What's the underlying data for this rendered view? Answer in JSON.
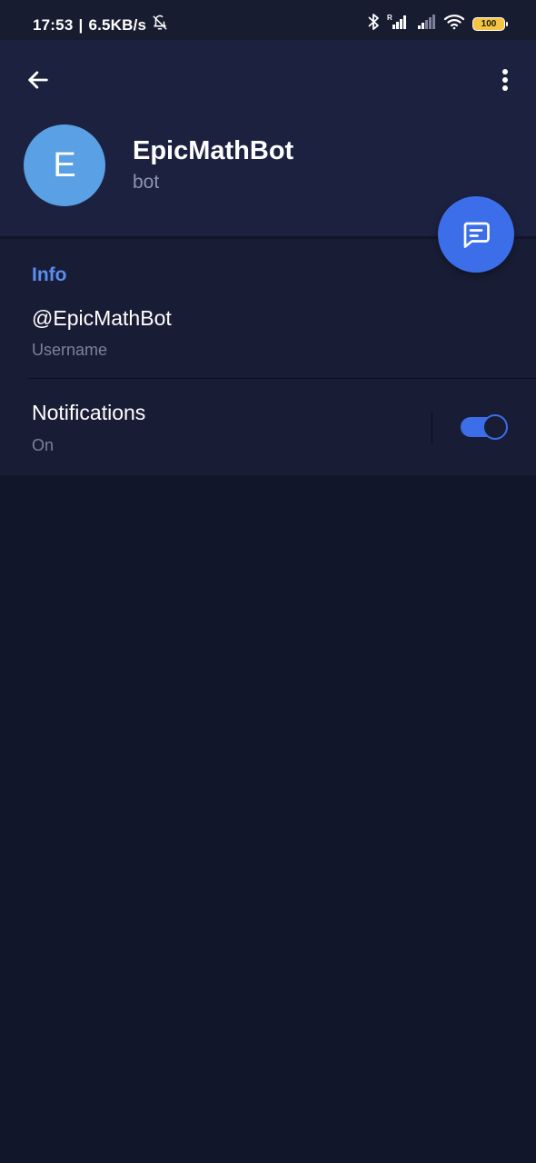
{
  "status_bar": {
    "time": "17:53",
    "speed": "6.5KB/s",
    "separator": "|",
    "battery": "100",
    "icons": [
      "mute-bell-icon",
      "bluetooth-icon",
      "signal-r-icon",
      "signal-icon",
      "wifi-icon",
      "battery-icon"
    ]
  },
  "toolbar": {
    "back_icon": "arrow-left-icon",
    "menu_icon": "more-vertical-icon"
  },
  "profile": {
    "avatar_letter": "E",
    "avatar_color": "#5aa0e4",
    "name": "EpicMathBot",
    "status": "bot",
    "fab_icon": "message-icon"
  },
  "info": {
    "section_title": "Info",
    "username_value": "@EpicMathBot",
    "username_label": "Username",
    "notifications_title": "Notifications",
    "notifications_status": "On",
    "notifications_enabled": true
  },
  "colors": {
    "accent": "#3b6ee8",
    "section_title": "#5b8ef0",
    "header_bg": "#1c2140",
    "page_bg": "#12162a"
  }
}
